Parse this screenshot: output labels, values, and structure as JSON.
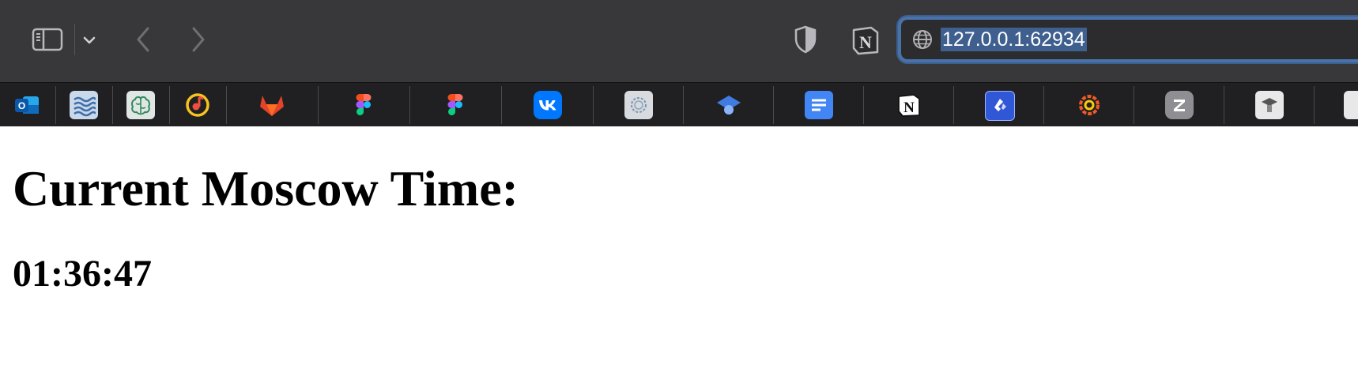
{
  "browser": {
    "address_bar": {
      "url": "127.0.0.1:62934"
    },
    "toolbar": {
      "icons": [
        "sidebar-icon",
        "chevron-down-icon",
        "back-arrow-icon",
        "forward-arrow-icon",
        "privacy-shield-icon",
        "notion-extension-icon",
        "globe-icon"
      ]
    },
    "bookmarks": [
      {
        "icon": "outlook-icon",
        "color": "#0f6cbd"
      },
      {
        "icon": "waves-icon",
        "color": "#9fb8d8"
      },
      {
        "icon": "brain-icon",
        "color": "#3c9a6a"
      },
      {
        "icon": "music-icon",
        "color": "#f7c31e"
      },
      {
        "icon": "gitlab-icon",
        "color": "#e24329"
      },
      {
        "icon": "figma-icon",
        "color": "#a259ff"
      },
      {
        "icon": "figma-icon",
        "color": "#a259ff"
      },
      {
        "icon": "vk-icon",
        "color": "#0077ff"
      },
      {
        "icon": "globe-sketch-icon",
        "color": "#d7dbe0"
      },
      {
        "icon": "graduation-cap-icon",
        "color": "#3f7be0"
      },
      {
        "icon": "docs-icon",
        "color": "#4285f4"
      },
      {
        "icon": "notion-icon",
        "color": "#ffffff"
      },
      {
        "icon": "jira-like-icon",
        "color": "#2f57d6"
      },
      {
        "icon": "grafana-icon",
        "color": "#f05a28"
      },
      {
        "icon": "zotero-icon",
        "color": "#8e8e93"
      },
      {
        "icon": "scholar-icon",
        "color": "#e8e8e8"
      }
    ]
  },
  "page": {
    "title": "Current Moscow Time:",
    "time": "01:36:47"
  }
}
